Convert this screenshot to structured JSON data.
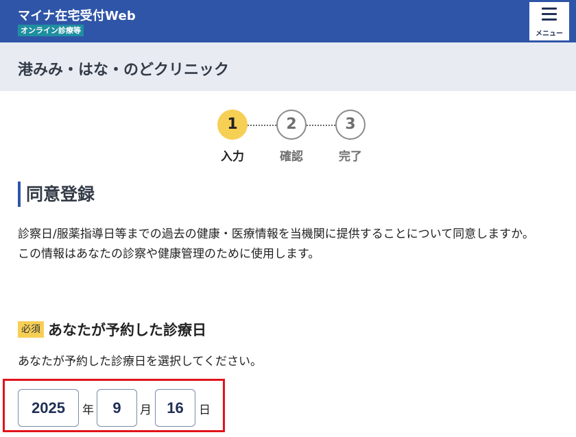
{
  "header": {
    "app_title": "マイナ在宅受付Web",
    "app_subtitle": "オンライン診療等",
    "menu_label": "メニュー"
  },
  "clinic": {
    "name": "港みみ・はな・のどクリニック"
  },
  "steps": [
    {
      "number": "1",
      "label": "入力",
      "state": "active"
    },
    {
      "number": "2",
      "label": "確認",
      "state": "inactive"
    },
    {
      "number": "3",
      "label": "完了",
      "state": "inactive"
    }
  ],
  "section": {
    "title": "同意登録"
  },
  "consent": {
    "line1": "診察日/服薬指導日等までの過去の健康・医療情報を当機関に提供することについて同意しますか。",
    "line2": "この情報はあなたの診察や健康管理のために使用します。"
  },
  "question": {
    "required_badge": "必須",
    "title": "あなたが予約した診療日",
    "description": "あなたが予約した診療日を選択してください。"
  },
  "date": {
    "year": "2025",
    "year_unit": "年",
    "month": "9",
    "month_unit": "月",
    "day": "16",
    "day_unit": "日"
  },
  "colors": {
    "header_bg": "#2f55a8",
    "accent_yellow": "#f6cf55",
    "highlight_red": "#e0131a"
  }
}
